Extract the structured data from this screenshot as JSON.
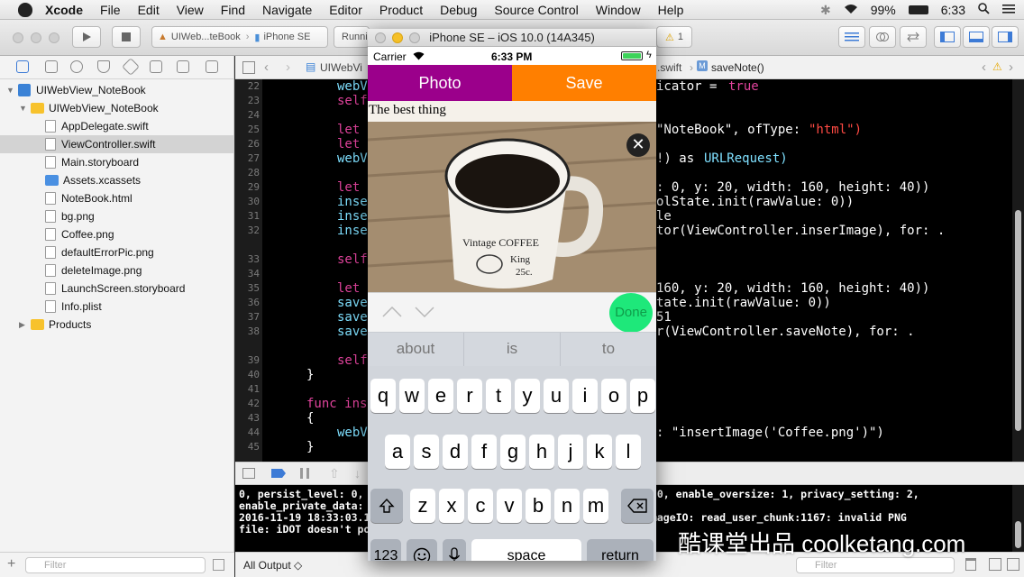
{
  "menubar": {
    "app": "Xcode",
    "items": [
      "File",
      "Edit",
      "View",
      "Find",
      "Navigate",
      "Editor",
      "Product",
      "Debug",
      "Source Control",
      "Window",
      "Help"
    ],
    "battery": "99%",
    "clock": "6:33"
  },
  "toolbar": {
    "scheme": "UIWeb...teBook",
    "device": "iPhone SE",
    "status": "Runni",
    "warning_count": "1"
  },
  "navigator": {
    "project": "UIWebView_NoteBook",
    "group": "UIWebView_NoteBook",
    "files": [
      "AppDelegate.swift",
      "ViewController.swift",
      "Main.storyboard",
      "Assets.xcassets",
      "NoteBook.html",
      "bg.png",
      "Coffee.png",
      "defaultErrorPic.png",
      "deleteImage.png",
      "LaunchScreen.storyboard",
      "Info.plist"
    ],
    "products": "Products",
    "filter_placeholder": "Filter"
  },
  "jumpbar": {
    "left": "UIWebVi",
    "file": ".swift",
    "method": "saveNote()"
  },
  "code": {
    "line_numbers": [
      "22",
      "23",
      "24",
      "25",
      "26",
      "27",
      "28",
      "29",
      "30",
      "31",
      "32",
      "",
      "33",
      "34",
      "35",
      "36",
      "37",
      "38",
      "",
      "39",
      "40",
      "41",
      "42",
      "43",
      "44",
      "45"
    ],
    "lines": [
      {
        "pre": "webV",
        "post": "icator = ",
        "tail": "true"
      },
      {
        "pre": "self",
        "post": "",
        "tail": ""
      },
      {
        "pre": "",
        "post": "",
        "tail": ""
      },
      {
        "pre": "let",
        "post": "\"NoteBook\", ofType: ",
        "tail": "\"html\")"
      },
      {
        "pre": "let",
        "post": "",
        "tail": ""
      },
      {
        "pre": "webV",
        "post": "!) as ",
        "tail": "URLRequest)"
      },
      {
        "pre": "",
        "post": "",
        "tail": ""
      },
      {
        "pre": "let",
        "post": ": 0, y: 20, width: 160, height: 40))",
        "tail": ""
      },
      {
        "pre": "inse",
        "post": "olState.init(rawValue: 0))",
        "tail": ""
      },
      {
        "pre": "inse",
        "post": "le",
        "tail": ""
      },
      {
        "pre": "inse",
        "post": "tor(ViewController.inserImage), for: .",
        "tail": ""
      },
      {
        "pre": "",
        "post": "",
        "tail": ""
      },
      {
        "pre": "self",
        "post": "",
        "tail": ""
      },
      {
        "pre": "",
        "post": "",
        "tail": ""
      },
      {
        "pre": "let",
        "post": "160, y: 20, width: 160, height: 40))",
        "tail": ""
      },
      {
        "pre": "save",
        "post": "tate.init(rawValue: 0))",
        "tail": ""
      },
      {
        "pre": "save",
        "post": "51",
        "tail": ""
      },
      {
        "pre": "save",
        "post": "r(ViewController.saveNote), for: .",
        "tail": ""
      },
      {
        "pre": "",
        "post": "",
        "tail": ""
      },
      {
        "pre": "self",
        "post": "",
        "tail": ""
      },
      {
        "pre": "}",
        "post": "",
        "tail": ""
      },
      {
        "pre": "",
        "post": "",
        "tail": ""
      },
      {
        "pre": "func ins",
        "post": "",
        "tail": ""
      },
      {
        "pre": "{",
        "post": "",
        "tail": ""
      },
      {
        "pre": "webV",
        "post": ": \"insertImage('Coffee.png')\")",
        "tail": ""
      },
      {
        "pre": "}",
        "post": "",
        "tail": ""
      }
    ]
  },
  "console": {
    "lines": [
      "0, persist_level: 0,                                rate_symptoms: 0, enable_oversize: 1, privacy_setting: 2,",
      "enable_private_data:",
      "2016-11-19 18:33:03.1                               ew_NoteBook] ImageIO: read_user_chunk:1167: invalid PNG",
      "file: iDOT doesn't po"
    ],
    "output_selector": "All Output ◇",
    "filter_placeholder": "Filter"
  },
  "watermark": "酷课堂出品 coolketang.com",
  "simulator": {
    "title": "iPhone SE – iOS 10.0 (14A345)",
    "carrier": "Carrier",
    "time": "6:33 PM",
    "photo_button": "Photo",
    "save_button": "Save",
    "web_text": "The best thing",
    "done_label": "Done",
    "suggestions": [
      "about",
      "is",
      "to"
    ],
    "keys_row1": [
      "q",
      "w",
      "e",
      "r",
      "t",
      "y",
      "u",
      "i",
      "o",
      "p"
    ],
    "keys_row2": [
      "a",
      "s",
      "d",
      "f",
      "g",
      "h",
      "j",
      "k",
      "l"
    ],
    "keys_row3": [
      "z",
      "x",
      "c",
      "v",
      "b",
      "n",
      "m"
    ],
    "key_numbers": "123",
    "key_space": "space",
    "key_return": "return",
    "mug_text_1": "Vintage COFFEE",
    "mug_text_2": "King",
    "mug_text_3": "25c."
  },
  "colors": {
    "photo_bar": "#9b008b",
    "save_bar": "#ff7f00",
    "done_button": "#1ee87a",
    "keyword": "#e0439c",
    "type": "#7fe0ff",
    "string": "#ff4a43",
    "number": "#a08fff"
  }
}
